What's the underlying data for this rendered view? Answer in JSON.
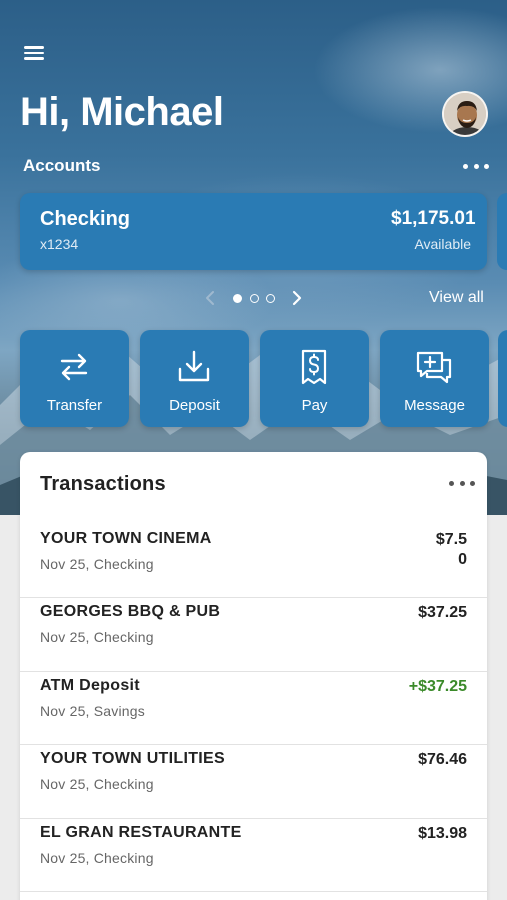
{
  "header": {
    "greeting": "Hi, Michael",
    "menu_icon": "menu-icon",
    "avatar_icon": "user-avatar"
  },
  "accounts": {
    "label": "Accounts",
    "more_icon": "more-horizontal-icon",
    "cards": [
      {
        "name": "Checking",
        "number": "x1234",
        "balance": "$1,175.01",
        "balance_label": "Available"
      }
    ],
    "pager": {
      "pages": 3,
      "active": 0
    },
    "view_all": "View all"
  },
  "actions": [
    {
      "label": "Transfer",
      "icon": "transfer-icon"
    },
    {
      "label": "Deposit",
      "icon": "download-icon"
    },
    {
      "label": "Pay",
      "icon": "bill-icon"
    },
    {
      "label": "Message",
      "icon": "message-add-icon"
    }
  ],
  "transactions": {
    "title": "Transactions",
    "more_icon": "more-horizontal-icon",
    "items": [
      {
        "name": "YOUR TOWN CINEMA",
        "meta": "Nov 25, Checking",
        "amount": "$7.50"
      },
      {
        "name": "GEORGES BBQ & PUB",
        "meta": "Nov 25, Checking",
        "amount": "$37.25"
      },
      {
        "name": "ATM Deposit",
        "meta": "Nov 25, Savings",
        "amount": "+$37.25"
      },
      {
        "name": "YOUR TOWN UTILITIES",
        "meta": "Nov 25, Checking",
        "amount": "$76.46"
      },
      {
        "name": "EL GRAN RESTAURANTE",
        "meta": "Nov 25, Checking",
        "amount": "$13.98"
      }
    ]
  },
  "colors": {
    "card": "#2a7bb4",
    "credit": "#3b8a2a",
    "text": "#222222"
  }
}
